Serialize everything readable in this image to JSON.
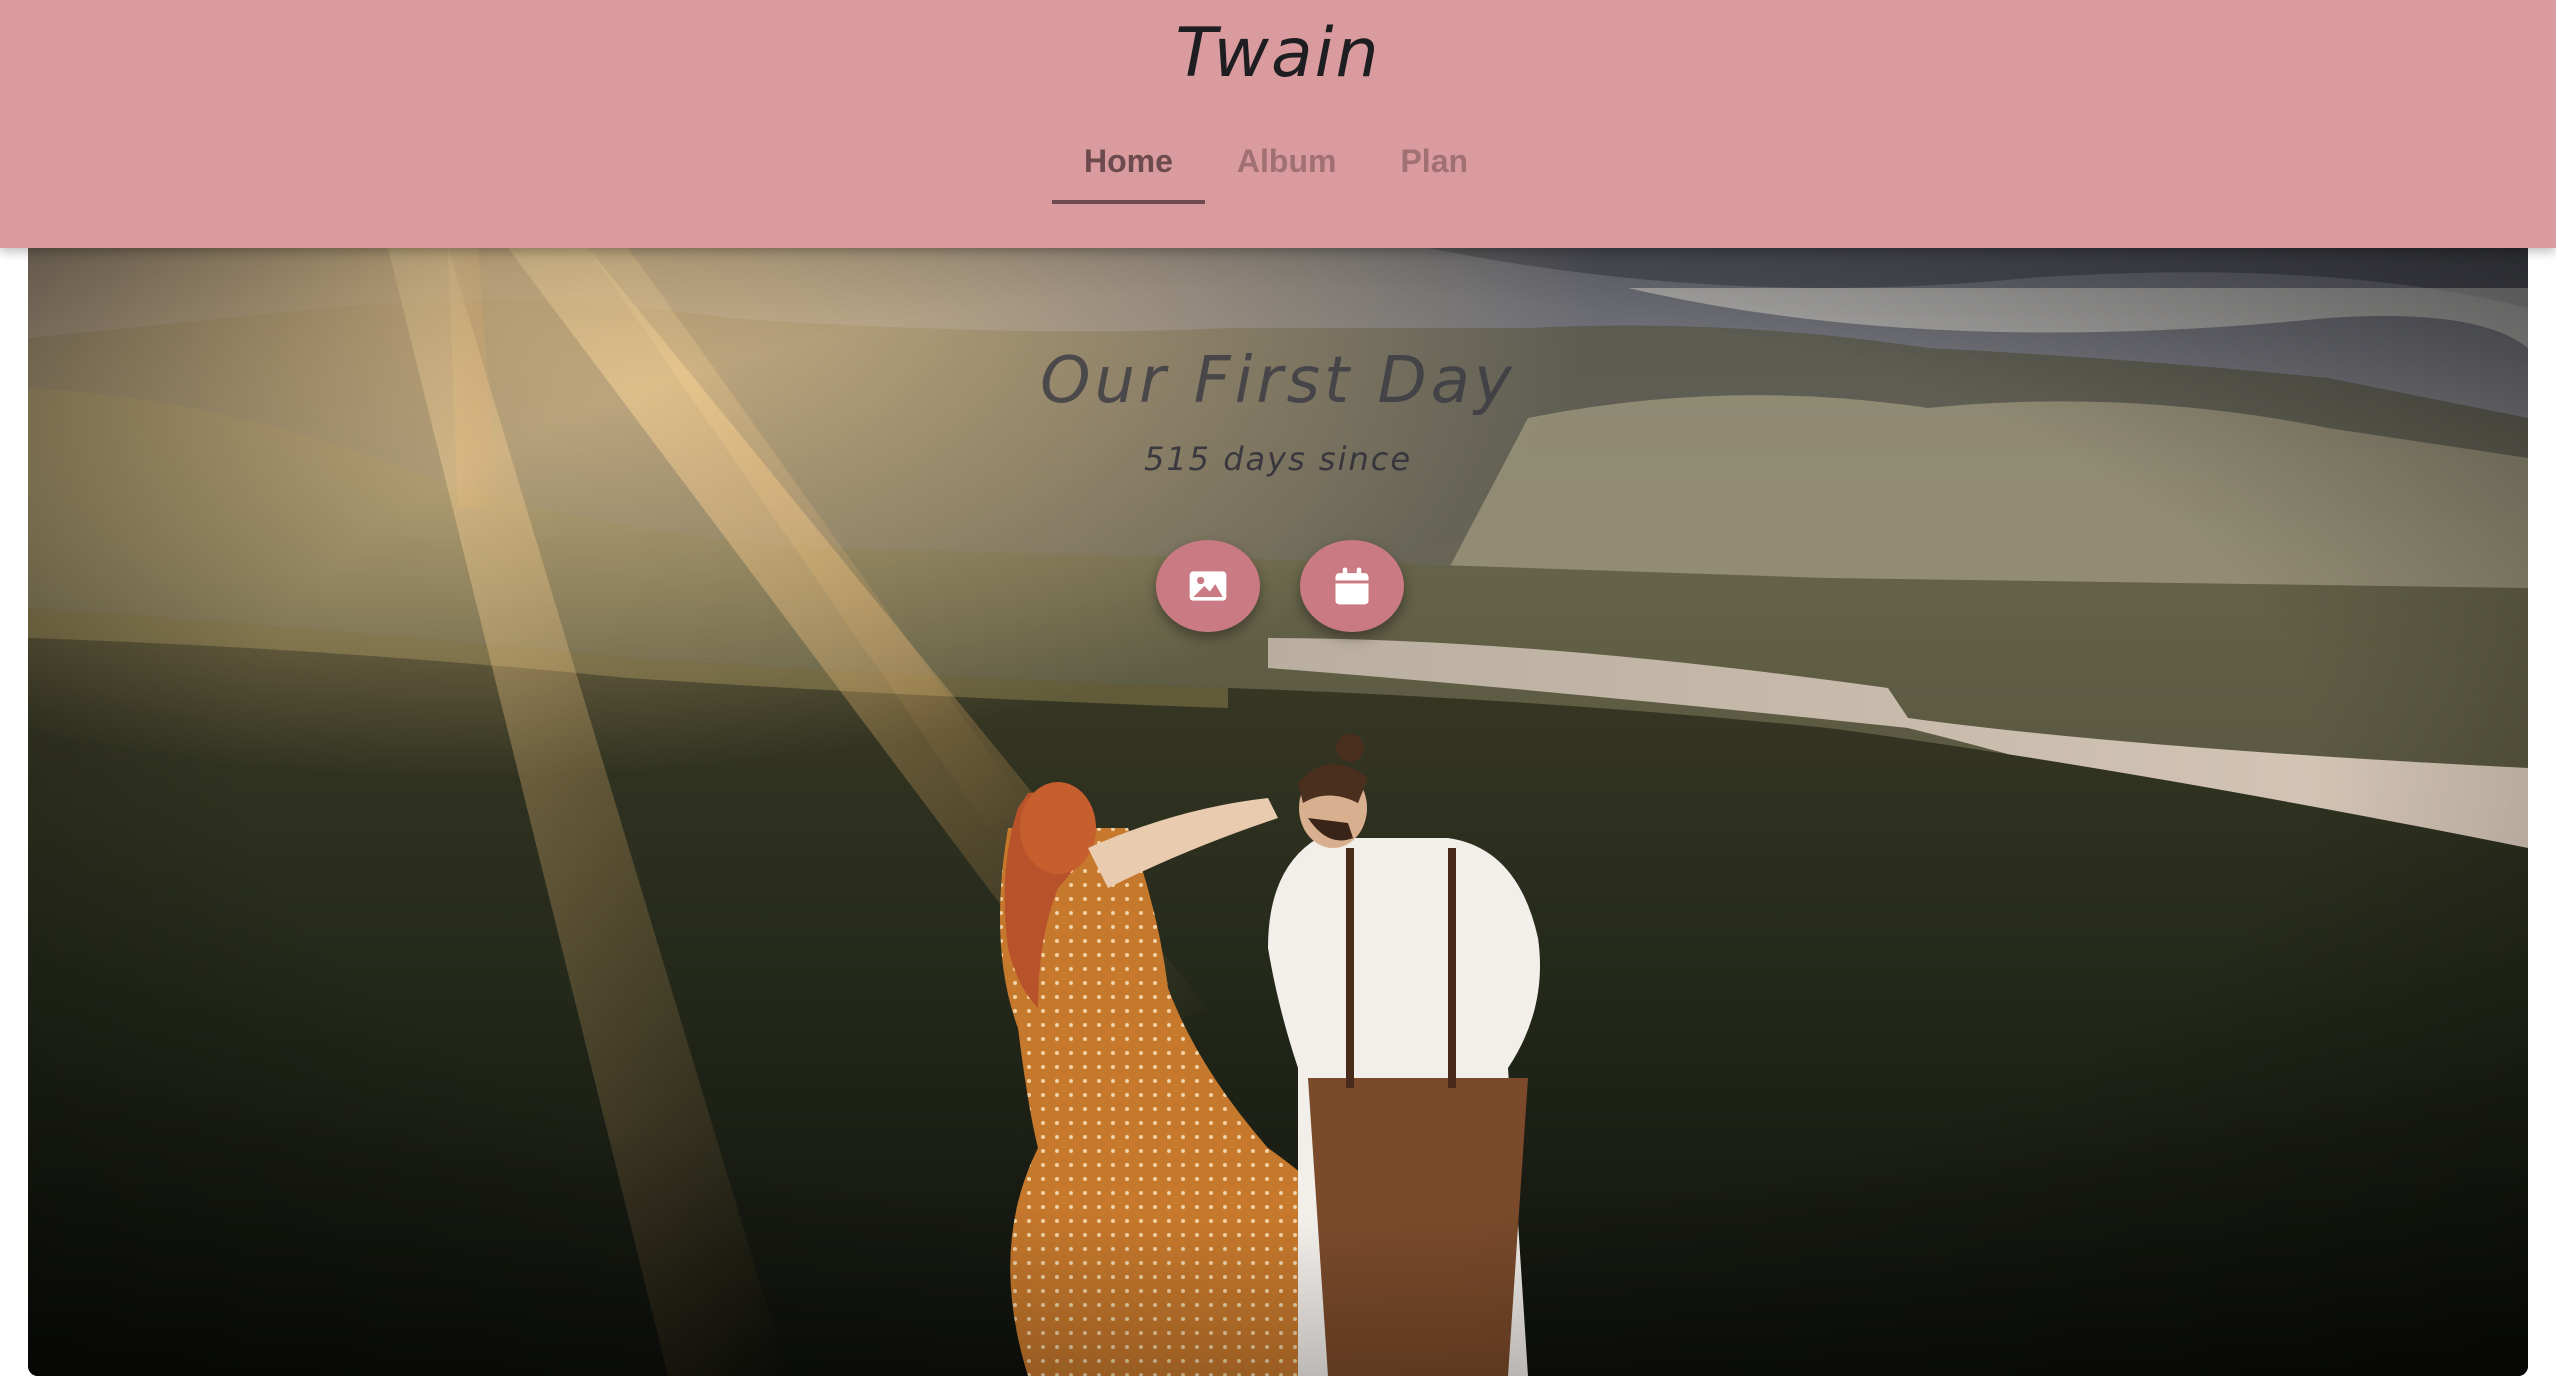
{
  "app": {
    "title": "Twain"
  },
  "nav": {
    "tabs": [
      {
        "label": "Home",
        "active": true
      },
      {
        "label": "Album",
        "active": false
      },
      {
        "label": "Plan",
        "active": false
      }
    ]
  },
  "hero": {
    "title": "Our First Day",
    "subtitle": "515 days since",
    "actions": [
      {
        "icon": "image-icon"
      },
      {
        "icon": "calendar-icon"
      }
    ]
  },
  "colors": {
    "header": "#d99b9e",
    "accent_button": "#c97a82",
    "active_tab": "#6c4a4d"
  }
}
